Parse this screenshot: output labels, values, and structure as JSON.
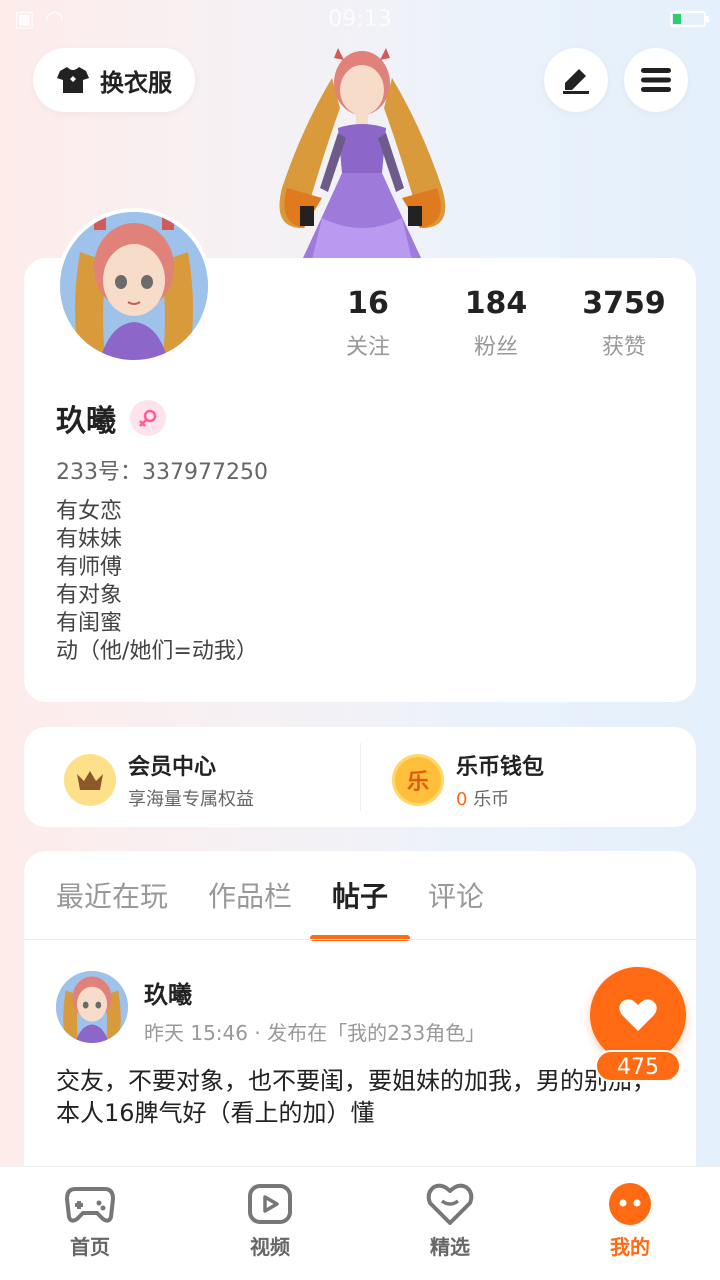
{
  "status_bar": {
    "time": "09:13"
  },
  "header": {
    "dress_button_label": "换衣服"
  },
  "profile": {
    "name": "玖曦",
    "uid_label": "233号：337977250",
    "stats": [
      {
        "value": "16",
        "label": "关注"
      },
      {
        "value": "184",
        "label": "粉丝"
      },
      {
        "value": "3759",
        "label": "获赞"
      }
    ],
    "bio_lines": [
      "有女恋",
      "有妹妹",
      "有师傅",
      "有对象",
      "有闺蜜",
      "动（他/她们=动我）"
    ]
  },
  "vip": {
    "member_title": "会员中心",
    "member_sub": "享海量专属权益",
    "wallet_title": "乐币钱包",
    "wallet_amount": "0",
    "wallet_unit": "乐币",
    "coin_glyph": "乐"
  },
  "tabs": [
    {
      "label": "最近在玩",
      "active": false
    },
    {
      "label": "作品栏",
      "active": false
    },
    {
      "label": "帖子",
      "active": true
    },
    {
      "label": "评论",
      "active": false
    }
  ],
  "post": {
    "author": "玖曦",
    "meta": "昨天 15:46 · 发布在「我的233角色」",
    "text": "交友，不要对象，也不要闺，要姐妹的加我，男的别加，本人16脾气好（看上的加）懂",
    "like_count": "475"
  },
  "bottom_nav": [
    {
      "label": "首页",
      "icon": "gamepad-icon",
      "active": false
    },
    {
      "label": "视频",
      "icon": "video-icon",
      "active": false
    },
    {
      "label": "精选",
      "icon": "heart-chat-icon",
      "active": false
    },
    {
      "label": "我的",
      "icon": "profile-icon",
      "active": true
    }
  ],
  "colors": {
    "accent": "#ff6a13",
    "gender_female": "#ff5d8f"
  }
}
